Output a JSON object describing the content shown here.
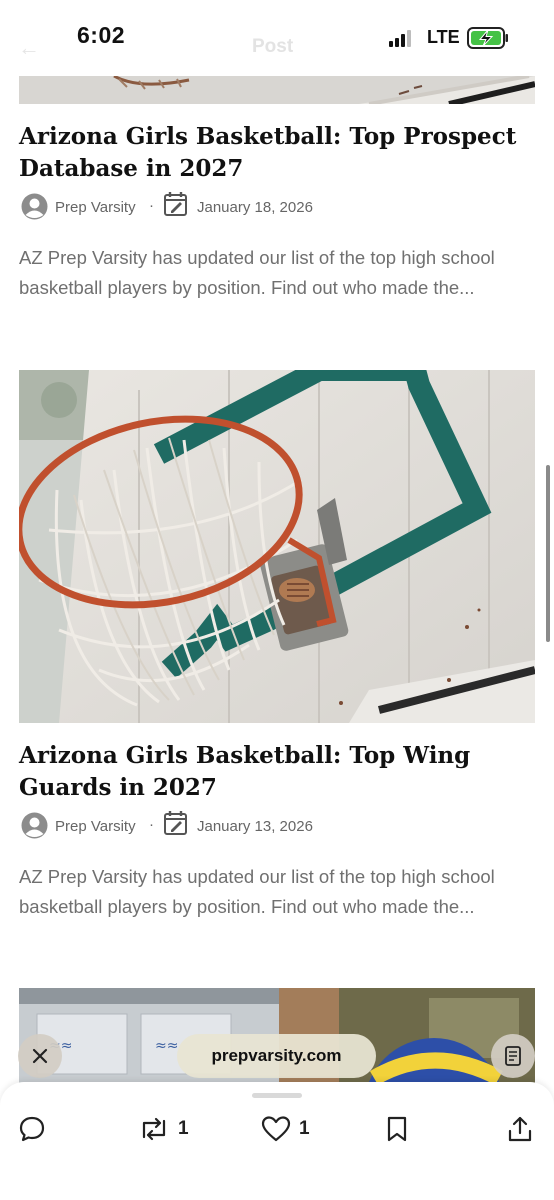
{
  "status_bar": {
    "time": "6:02",
    "network": "LTE",
    "ghost_back": "←",
    "ghost_title": "Post"
  },
  "articles": [
    {
      "title": "Arizona Girls Basketball: Top Prospect Database in 2027",
      "author": "Prep Varsity",
      "separator": "·",
      "date": "January 18, 2026",
      "excerpt": "AZ Prep Varsity has updated our list of the top high school basketball players by position. Find out who made the..."
    },
    {
      "title": "Arizona Girls Basketball: Top Wing Guards in 2027",
      "author": "Prep Varsity",
      "separator": "·",
      "date": "January 13, 2026",
      "excerpt": "AZ Prep Varsity has updated our list of the top high school basketball players by position. Find out who made the..."
    }
  ],
  "browser": {
    "url": "prepvarsity.com"
  },
  "actions": {
    "retweet_count": "1",
    "like_count": "1"
  },
  "icons": {
    "avatar": "person-circle-icon",
    "date": "calendar-edit-icon",
    "close": "close-icon",
    "reader": "reader-mode-icon",
    "reply": "comment-icon",
    "retweet": "repost-icon",
    "like": "heart-icon",
    "bookmark": "bookmark-icon",
    "share": "share-icon"
  },
  "colors": {
    "battery": "#45c246",
    "rim": "#c0502e",
    "backboard_square": "#1f6b63",
    "url_pill": "#f3e7a0"
  }
}
